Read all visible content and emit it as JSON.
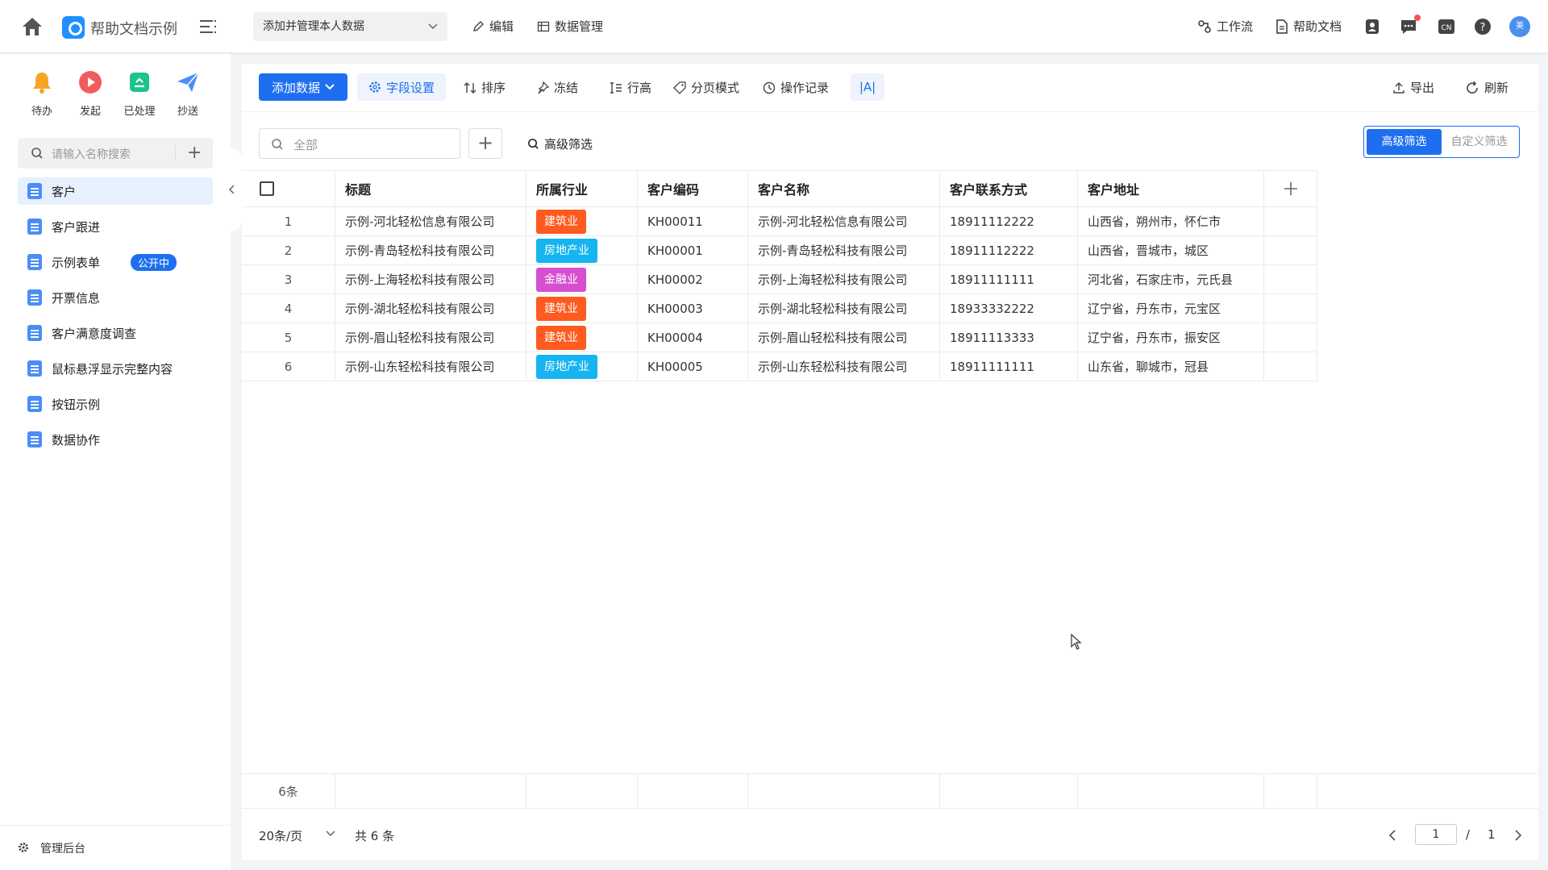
{
  "header": {
    "app_title": "帮助文档示例",
    "scope_select": "添加并管理本人数据",
    "edit_label": "编辑",
    "data_mgmt_label": "数据管理",
    "workflow_label": "工作流",
    "help_doc_label": "帮助文档",
    "avatar_text": "美"
  },
  "sidebar": {
    "quick_actions": [
      {
        "label": "待办",
        "icon": "bell-icon",
        "color": "#f5a623"
      },
      {
        "label": "发起",
        "icon": "play-icon",
        "color": "#f25b5b"
      },
      {
        "label": "已处理",
        "icon": "check-edit-icon",
        "color": "#1ec28b"
      },
      {
        "label": "抄送",
        "icon": "send-icon",
        "color": "#4b8df8"
      }
    ],
    "search_placeholder": "请输入名称搜索",
    "items": [
      {
        "label": "客户",
        "active": true
      },
      {
        "label": "客户跟进"
      },
      {
        "label": "示例表单",
        "badge": "公开中"
      },
      {
        "label": "开票信息"
      },
      {
        "label": "客户满意度调查"
      },
      {
        "label": "鼠标悬浮显示完整内容"
      },
      {
        "label": "按钮示例"
      },
      {
        "label": "数据协作"
      }
    ],
    "footer_label": "管理后台"
  },
  "toolbar": {
    "add_data": "添加数据",
    "field_settings": "字段设置",
    "sort": "排序",
    "freeze": "冻结",
    "row_height": "行高",
    "pagination_mode": "分页模式",
    "operation_log": "操作记录",
    "font_toggle": "|A|",
    "export": "导出",
    "refresh": "刷新"
  },
  "filter": {
    "search_placeholder": "全部",
    "advanced_link": "高级筛选",
    "seg_advanced": "高级筛选",
    "seg_custom": "自定义筛选"
  },
  "table": {
    "columns": [
      "标题",
      "所属行业",
      "客户编码",
      "客户名称",
      "客户联系方式",
      "客户地址"
    ],
    "rows": [
      {
        "no": "1",
        "title": "示例-河北轻松信息有限公司",
        "industry": "建筑业",
        "industry_color": "#ff5a1f",
        "code": "KH00011",
        "name": "示例-河北轻松信息有限公司",
        "phone": "18911112222",
        "address": "山西省，朔州市，怀仁市"
      },
      {
        "no": "2",
        "title": "示例-青岛轻松科技有限公司",
        "industry": "房地产业",
        "industry_color": "#16b4f0",
        "code": "KH00001",
        "name": "示例-青岛轻松科技有限公司",
        "phone": "18911112222",
        "address": "山西省，晋城市，城区"
      },
      {
        "no": "3",
        "title": "示例-上海轻松科技有限公司",
        "industry": "金融业",
        "industry_color": "#d64fd0",
        "code": "KH00002",
        "name": "示例-上海轻松科技有限公司",
        "phone": "18911111111",
        "address": "河北省，石家庄市，元氏县"
      },
      {
        "no": "4",
        "title": "示例-湖北轻松科技有限公司",
        "industry": "建筑业",
        "industry_color": "#ff5a1f",
        "code": "KH00003",
        "name": "示例-湖北轻松科技有限公司",
        "phone": "18933332222",
        "address": "辽宁省，丹东市，元宝区"
      },
      {
        "no": "5",
        "title": "示例-眉山轻松科技有限公司",
        "industry": "建筑业",
        "industry_color": "#ff5a1f",
        "code": "KH00004",
        "name": "示例-眉山轻松科技有限公司",
        "phone": "18911113333",
        "address": "辽宁省，丹东市，振安区"
      },
      {
        "no": "6",
        "title": "示例-山东轻松科技有限公司",
        "industry": "房地产业",
        "industry_color": "#16b4f0",
        "code": "KH00005",
        "name": "示例-山东轻松科技有限公司",
        "phone": "18911111111",
        "address": "山东省，聊城市，冠县"
      }
    ],
    "row_count": "6条"
  },
  "pager": {
    "page_size": "20条/页",
    "total": "共 6 条",
    "current_page": "1",
    "separator": "/",
    "total_pages": "1"
  }
}
